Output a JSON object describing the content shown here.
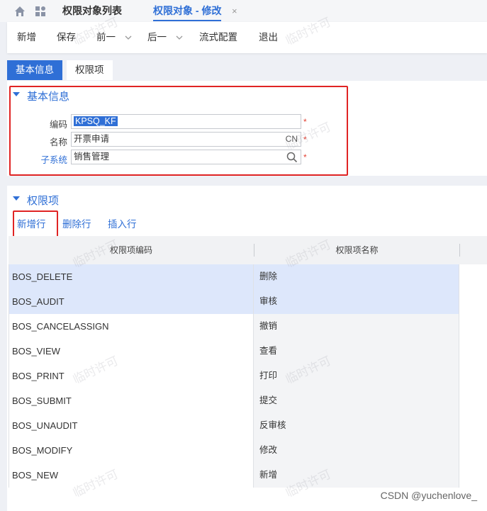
{
  "topbar": {
    "tabs": [
      {
        "label": "权限对象列表",
        "active": false
      },
      {
        "label": "权限对象 - 修改",
        "active": true
      }
    ],
    "close_glyph": "×",
    "icons": [
      "home-icon",
      "app-grid-icon"
    ]
  },
  "toolbar": {
    "items": [
      "新增",
      "保存",
      "前一",
      "后一",
      "流式配置",
      "退出"
    ]
  },
  "subtabs": [
    "基本信息",
    "权限项"
  ],
  "basic": {
    "title": "基本信息",
    "fields": [
      {
        "label": "编码",
        "value": "KPSQ_KF",
        "required": true
      },
      {
        "label": "名称",
        "value": "开票申请",
        "suffix": "CN",
        "required": true
      },
      {
        "label": "子系统",
        "value": "销售管理",
        "required": true
      }
    ]
  },
  "items_section": {
    "title": "权限项",
    "actions": [
      "新增行",
      "删除行",
      "插入行"
    ],
    "columns": [
      "权限项编码",
      "权限项名称"
    ],
    "rows": [
      {
        "code": "BOS_DELETE",
        "name": "删除",
        "selected": true
      },
      {
        "code": "BOS_AUDIT",
        "name": "审核",
        "selected": true
      },
      {
        "code": "BOS_CANCELASSIGN",
        "name": "撤销",
        "selected": false
      },
      {
        "code": "BOS_VIEW",
        "name": "查看",
        "selected": false
      },
      {
        "code": "BOS_PRINT",
        "name": "打印",
        "selected": false
      },
      {
        "code": "BOS_SUBMIT",
        "name": "提交",
        "selected": false
      },
      {
        "code": "BOS_UNAUDIT",
        "name": "反审核",
        "selected": false
      },
      {
        "code": "BOS_MODIFY",
        "name": "修改",
        "selected": false
      },
      {
        "code": "BOS_NEW",
        "name": "新增",
        "selected": false
      }
    ]
  },
  "watermark": "临时许可",
  "credit": "CSDN @yuchenlove_",
  "colors": {
    "accent": "#2f6fd6",
    "highlight": "#e02424",
    "selected_row": "#dde7fb"
  }
}
